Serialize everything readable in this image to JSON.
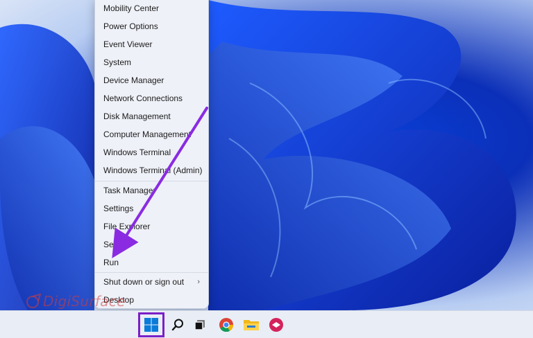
{
  "context_menu": {
    "items": [
      {
        "label": "Mobility Center"
      },
      {
        "label": "Power Options"
      },
      {
        "label": "Event Viewer"
      },
      {
        "label": "System"
      },
      {
        "label": "Device Manager"
      },
      {
        "label": "Network Connections"
      },
      {
        "label": "Disk Management"
      },
      {
        "label": "Computer Management"
      },
      {
        "label": "Windows Terminal"
      },
      {
        "label": "Windows Terminal (Admin)"
      },
      {
        "label": "Task Manager"
      },
      {
        "label": "Settings"
      },
      {
        "label": "File Explorer"
      },
      {
        "label": "Search"
      },
      {
        "label": "Run"
      },
      {
        "label": "Shut down or sign out",
        "submenu": true
      },
      {
        "label": "Desktop"
      }
    ]
  },
  "taskbar": {
    "icons": [
      "windows-start-icon",
      "search-icon",
      "task-view-icon",
      "chrome-icon",
      "file-explorer-icon",
      "app-icon"
    ]
  },
  "watermark": {
    "text": "DigiSurface"
  },
  "colors": {
    "highlight": "#7b1fc7",
    "arrow": "#8a2be2",
    "menu_bg": "#eef1f8",
    "taskbar_bg": "#e9eef6"
  }
}
